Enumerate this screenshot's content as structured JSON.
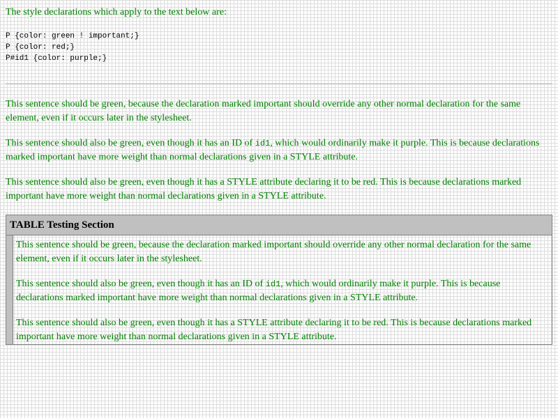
{
  "intro_text": "The style declarations which apply to the text below are:",
  "declarations": [
    "P {color: green ! important;}",
    "P {color: red;}",
    "P#id1 {color: purple;}"
  ],
  "paragraph_1": "This sentence should be green, because the declaration marked important should override any other normal declaration for the same element, even if it occurs later in the stylesheet.",
  "paragraph_2": {
    "before": "This sentence should also be green, even though it has an ID of ",
    "code": "id1",
    "after": ", which would ordinarily make it purple. This is because declarations marked important have more weight than normal declarations given in a STYLE attribute."
  },
  "paragraph_3": "This sentence should also be green, even though it has a STYLE attribute declaring it to be red. This is because declarations marked important have more weight than normal declarations given in a STYLE attribute.",
  "table": {
    "title": "TABLE Testing Section"
  },
  "colors": {
    "text": "#008000",
    "declarations": "#000000",
    "table_header_bg": "#c0c0c0"
  }
}
